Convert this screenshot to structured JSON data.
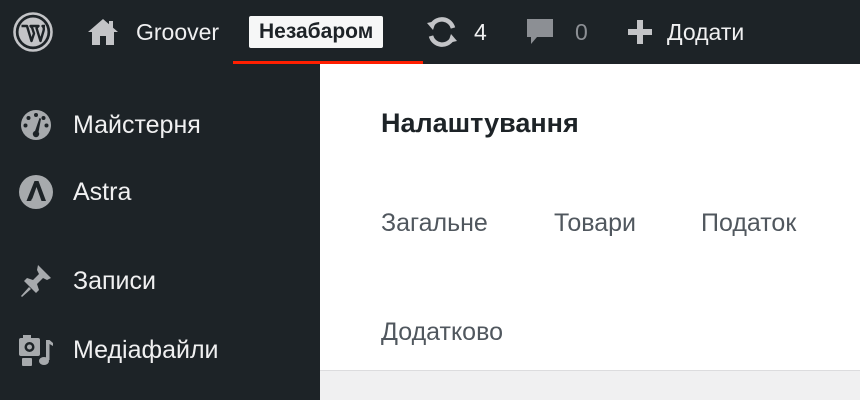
{
  "admin_bar": {
    "wp_logo_icon": "wordpress-logo-icon",
    "site_name": "Groover",
    "site_icon": "home-icon",
    "coming_soon_label": "Незабаром",
    "updates_icon": "updates-icon",
    "updates_count": "4",
    "comments_icon": "comment-icon",
    "comments_count": "0",
    "new_icon": "plus-icon",
    "new_label": "Додати"
  },
  "sidebar": {
    "items": [
      {
        "label": "Майстерня",
        "icon": "dashboard-gauge-icon"
      },
      {
        "label": "Astra",
        "icon": "astra-logo-icon"
      },
      {
        "label": "Записи",
        "icon": "pin-icon"
      },
      {
        "label": "Медіафайли",
        "icon": "media-icon"
      }
    ]
  },
  "main": {
    "title": "Налаштування",
    "tabs": [
      {
        "label": "Загальне"
      },
      {
        "label": "Товари"
      },
      {
        "label": "Податок"
      },
      {
        "label": "Додатково"
      }
    ]
  },
  "colors": {
    "admin_bar_bg": "#1d2327",
    "highlight_underline": "#ff1f00",
    "content_bg": "#ffffff"
  }
}
